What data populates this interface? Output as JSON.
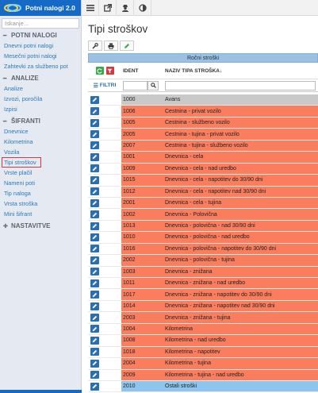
{
  "app": {
    "title": "Potni nalogi 2.0",
    "brand_color": "#1569c7"
  },
  "sidebar": {
    "search_placeholder": "Iskanje...",
    "sections": [
      {
        "label": "POTNI NALOGI",
        "icon": "minus-icon",
        "items": [
          {
            "label": "Dnevni potni nalogi"
          },
          {
            "label": "Mesečni potni nalogi"
          },
          {
            "label": "Zahtevki za službeno pot"
          }
        ]
      },
      {
        "label": "ANALIZE",
        "icon": "minus-icon",
        "items": [
          {
            "label": "Analize"
          },
          {
            "label": "Izvozi, poročila"
          },
          {
            "label": "Izpisi"
          }
        ]
      },
      {
        "label": "ŠIFRANTI",
        "icon": "minus-icon",
        "items": [
          {
            "label": "Dnevnice"
          },
          {
            "label": "Kilometrina"
          },
          {
            "label": "Vozila"
          },
          {
            "label": "Tipi stroškov",
            "active": true
          },
          {
            "label": "Vrste plačil"
          },
          {
            "label": "Nameni poti"
          },
          {
            "label": "Tip naloga"
          },
          {
            "label": "Vrsta stroška"
          },
          {
            "label": "Mini šifrant"
          }
        ]
      },
      {
        "label": "NASTAVITVE",
        "icon": "plus-icon",
        "items": []
      }
    ]
  },
  "topbar": {
    "icons": [
      "list-icon",
      "external-link-icon",
      "user-secret-icon",
      "contrast-icon"
    ]
  },
  "page": {
    "title": "Tipi stroškov"
  },
  "toolbar": {
    "icons": [
      "wrench-icon",
      "print-icon",
      "edit-icon"
    ]
  },
  "table": {
    "band_label": "Ročni stroški",
    "columns": {
      "ident": "IDENT",
      "naziv": "NAZIV TIPA STROŠKA"
    },
    "sort_indicator": "↓",
    "filter_label": "FILTRI",
    "colors": {
      "header_band": "#9ac0e3",
      "row_orange": "#fa7d5e",
      "row_grey": "#c9c9c9",
      "row_blue": "#8ec5ee",
      "edit_button": "#2a6fb2"
    },
    "rows": [
      {
        "ident": "1000",
        "naziv": "Avans",
        "color": "grey"
      },
      {
        "ident": "1006",
        "naziv": "Cestnina - privat vozilo",
        "color": "orange"
      },
      {
        "ident": "1005",
        "naziv": "Cestnina - službeno vozilo",
        "color": "orange"
      },
      {
        "ident": "2005",
        "naziv": "Cestnina - tujina - privat vozilo",
        "color": "orange"
      },
      {
        "ident": "2007",
        "naziv": "Cestnina - tujina - službeno vozilo",
        "color": "orange"
      },
      {
        "ident": "1001",
        "naziv": "Dnevnica - cela",
        "color": "orange"
      },
      {
        "ident": "1009",
        "naziv": "Dnevnica - cela - nad uredbo",
        "color": "orange"
      },
      {
        "ident": "1015",
        "naziv": "Dnevnica - cela - napotitev do 30/90 dni",
        "color": "orange"
      },
      {
        "ident": "1012",
        "naziv": "Dnevnica - cela - napotitev nad 30/90 dni",
        "color": "orange"
      },
      {
        "ident": "2001",
        "naziv": "Dnevnica - cela - tujina",
        "color": "orange"
      },
      {
        "ident": "1002",
        "naziv": "Dnevnica - Polovična",
        "color": "orange"
      },
      {
        "ident": "1013",
        "naziv": "Dnevnica - polovična - nad 30/90 dni",
        "color": "orange"
      },
      {
        "ident": "1010",
        "naziv": "Dnevnica - polovična - nad uredbo",
        "color": "orange"
      },
      {
        "ident": "1016",
        "naziv": "Dnevnica - polovična - napotitev do 30/90 dni",
        "color": "orange"
      },
      {
        "ident": "2002",
        "naziv": "Dnevnica - polovična - tujina",
        "color": "orange"
      },
      {
        "ident": "1003",
        "naziv": "Dnevnica - znižana",
        "color": "orange"
      },
      {
        "ident": "1011",
        "naziv": "Dnevnica - znižana - nad uredbo",
        "color": "orange"
      },
      {
        "ident": "1017",
        "naziv": "Dnevnica - znižana - napotitev do 30/90 dni",
        "color": "orange"
      },
      {
        "ident": "1014",
        "naziv": "Dnevnica - znižana - napotitev nad 30/90 dni",
        "color": "orange"
      },
      {
        "ident": "2003",
        "naziv": "Dnevnica - znižana - tujina",
        "color": "orange"
      },
      {
        "ident": "1004",
        "naziv": "Kilometrina",
        "color": "orange"
      },
      {
        "ident": "1008",
        "naziv": "Kilometrina - nad uredbo",
        "color": "orange"
      },
      {
        "ident": "1018",
        "naziv": "Kilometrina - napotitev",
        "color": "orange"
      },
      {
        "ident": "2004",
        "naziv": "Kilometrina - tujina",
        "color": "orange"
      },
      {
        "ident": "2009",
        "naziv": "Kilometrina - tujina - nad uredbo",
        "color": "orange"
      },
      {
        "ident": "2010",
        "naziv": "Ostali stroški",
        "color": "blue"
      }
    ]
  }
}
